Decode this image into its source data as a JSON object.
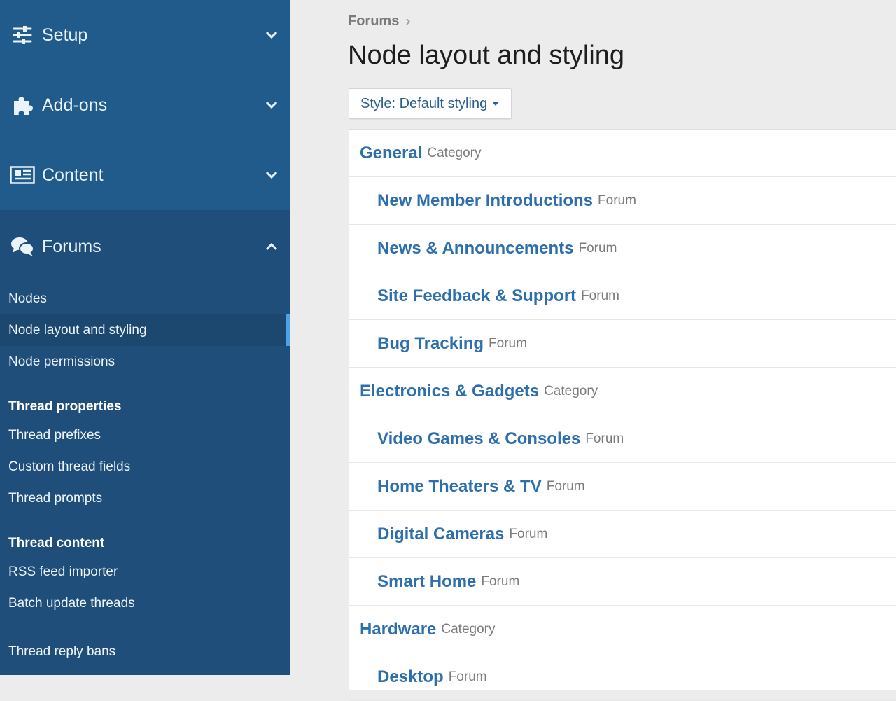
{
  "sidebar": {
    "groups": [
      {
        "label": "Setup",
        "icon": "sliders-icon",
        "expanded": false
      },
      {
        "label": "Add-ons",
        "icon": "puzzle-icon",
        "expanded": false
      },
      {
        "label": "Content",
        "icon": "newspaper-icon",
        "expanded": false
      },
      {
        "label": "Forums",
        "icon": "chat-bubbles-icon",
        "expanded": true
      }
    ],
    "forums": {
      "items": [
        "Nodes",
        "Node layout and styling",
        "Node permissions"
      ],
      "active_item": "Node layout and styling",
      "thread_properties": {
        "heading": "Thread properties",
        "items": [
          "Thread prefixes",
          "Custom thread fields",
          "Thread prompts"
        ]
      },
      "thread_content": {
        "heading": "Thread content",
        "items": [
          "RSS feed importer",
          "Batch update threads"
        ]
      },
      "extra_items": [
        "Thread reply bans"
      ]
    }
  },
  "main": {
    "breadcrumb": "Forums",
    "title": "Node layout and styling",
    "style_button": "Style: Default styling",
    "nodes": [
      {
        "title": "General",
        "type": "Category",
        "level": "category"
      },
      {
        "title": "New Member Introductions",
        "type": "Forum",
        "level": "forum"
      },
      {
        "title": "News & Announcements",
        "type": "Forum",
        "level": "forum"
      },
      {
        "title": "Site Feedback & Support",
        "type": "Forum",
        "level": "forum"
      },
      {
        "title": "Bug Tracking",
        "type": "Forum",
        "level": "forum"
      },
      {
        "title": "Electronics & Gadgets",
        "type": "Category",
        "level": "category"
      },
      {
        "title": "Video Games & Consoles",
        "type": "Forum",
        "level": "forum"
      },
      {
        "title": "Home Theaters & TV",
        "type": "Forum",
        "level": "forum"
      },
      {
        "title": "Digital Cameras",
        "type": "Forum",
        "level": "forum"
      },
      {
        "title": "Smart Home",
        "type": "Forum",
        "level": "forum"
      },
      {
        "title": "Hardware",
        "type": "Category",
        "level": "category"
      },
      {
        "title": "Desktop",
        "type": "Forum",
        "level": "forum"
      }
    ]
  },
  "colors": {
    "sidebar_bg": "#1f4e7a",
    "sidebar_top_bg": "#215b8b",
    "active_indicator": "#4aa3e8",
    "link_blue": "#2d6fad",
    "page_bg": "#ececec"
  }
}
